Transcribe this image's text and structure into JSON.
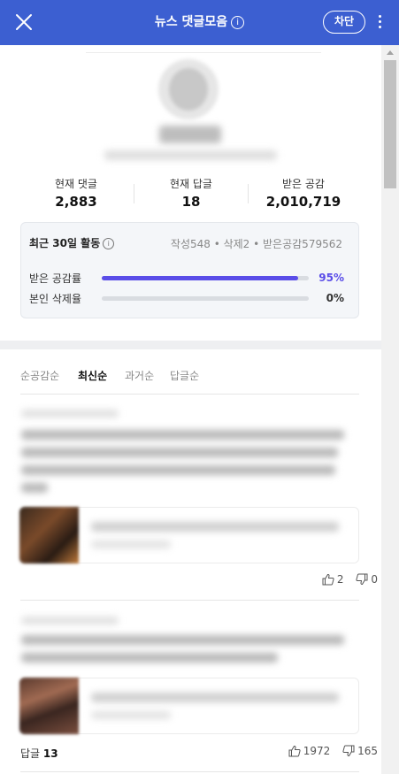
{
  "header": {
    "title": "뉴스 댓글모음",
    "info_glyph": "i",
    "block_label": "차단",
    "bg_color": "#3c5fd1"
  },
  "stats": [
    {
      "label": "현재 댓글",
      "value": "2,883"
    },
    {
      "label": "현재 답글",
      "value": "18"
    },
    {
      "label": "받은 공감",
      "value": "2,010,719"
    }
  ],
  "activity": {
    "title": "최근 30일 활동",
    "info_glyph": "i",
    "counts": "작성548 • 삭제2 • 받은공감579562",
    "rows": [
      {
        "label": "받은 공감률",
        "percent_text": "95%",
        "value": 0.95,
        "color": "#5a4de8"
      },
      {
        "label": "본인 삭제율",
        "percent_text": "0%",
        "value": 0.0,
        "color": "#5a4de8"
      }
    ]
  },
  "sort_tabs": [
    {
      "label": "순공감순",
      "active": false
    },
    {
      "label": "최신순",
      "active": true
    },
    {
      "label": "과거순",
      "active": false
    },
    {
      "label": "답글순",
      "active": false
    }
  ],
  "comments": [
    {
      "likes": "2",
      "dislikes": "0"
    },
    {
      "likes": "1972",
      "dislikes": "165",
      "reply_label": "답글",
      "reply_count": "13"
    }
  ],
  "icons": [
    "close-icon",
    "info-icon",
    "more-icon",
    "thumbs-up-icon",
    "thumbs-down-icon"
  ]
}
